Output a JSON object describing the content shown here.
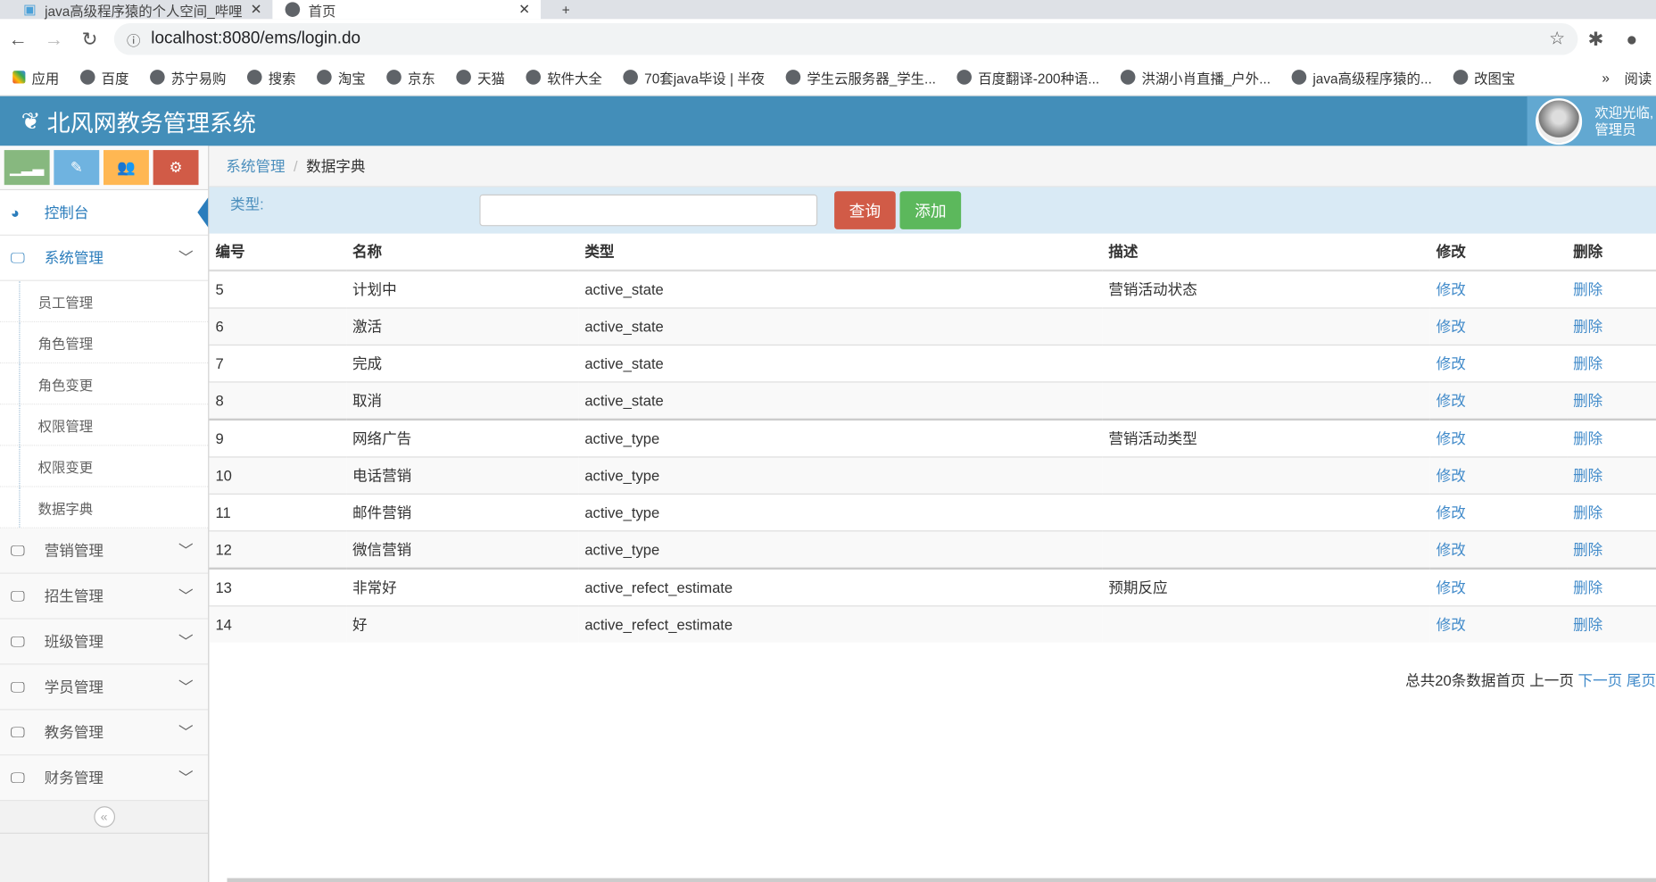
{
  "browser": {
    "tabs": [
      {
        "title": "java高级程序猿的个人空间_哔哩"
      },
      {
        "title": "首页"
      }
    ],
    "url": "localhost:8080/ems/login.do",
    "bookmarks": [
      "应用",
      "百度",
      "苏宁易购",
      "搜索",
      "淘宝",
      "京东",
      "天猫",
      "软件大全",
      "70套java毕设 | 半夜",
      "学生云服务器_学生...",
      "百度翻译-200种语...",
      "洪湖小肖直播_户外...",
      "java高级程序猿的...",
      "改图宝"
    ],
    "more": "»",
    "reading": "阅读"
  },
  "header": {
    "title": "北风网教务管理系统",
    "welcome": "欢迎光临,",
    "user": "管理员"
  },
  "sidebar": {
    "dashboard": "控制台",
    "system": "系统管理",
    "sub": [
      "员工管理",
      "角色管理",
      "角色变更",
      "权限管理",
      "权限变更",
      "数据字典"
    ],
    "menus": [
      "营销管理",
      "招生管理",
      "班级管理",
      "学员管理",
      "教务管理",
      "财务管理"
    ],
    "collapse": "«"
  },
  "colors": {
    "green": "#87b87f",
    "blue": "#6fb3e0",
    "orange": "#ffb752",
    "red": "#d15b47"
  },
  "breadcrumb": {
    "parent": "系统管理",
    "current": "数据字典"
  },
  "search": {
    "label": "类型:",
    "value": "",
    "query": "查询",
    "add": "添加"
  },
  "table": {
    "headers": [
      "编号",
      "名称",
      "类型",
      "描述",
      "修改",
      "删除"
    ],
    "rows": [
      [
        "5",
        "计划中",
        "active_state",
        "营销活动状态",
        "修改",
        "删除"
      ],
      [
        "6",
        "激活",
        "active_state",
        "",
        "修改",
        "删除"
      ],
      [
        "7",
        "完成",
        "active_state",
        "",
        "修改",
        "删除"
      ],
      [
        "8",
        "取消",
        "active_state",
        "",
        "修改",
        "删除"
      ],
      [
        "9",
        "网络广告",
        "active_type",
        "营销活动类型",
        "修改",
        "删除"
      ],
      [
        "10",
        "电话营销",
        "active_type",
        "",
        "修改",
        "删除"
      ],
      [
        "11",
        "邮件营销",
        "active_type",
        "",
        "修改",
        "删除"
      ],
      [
        "12",
        "微信营销",
        "active_type",
        "",
        "修改",
        "删除"
      ],
      [
        "13",
        "非常好",
        "active_refect_estimate",
        "预期反应",
        "修改",
        "删除"
      ],
      [
        "14",
        "好",
        "active_refect_estimate",
        "",
        "修改",
        "删除"
      ]
    ]
  },
  "pager": {
    "summary": "总共20条数据首页 上一页",
    "next": "下一页",
    "last": "尾页"
  }
}
